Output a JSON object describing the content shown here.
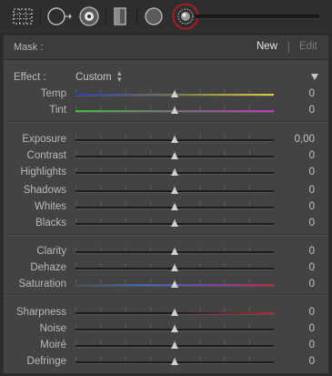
{
  "toolbar": {
    "tools": [
      {
        "name": "crop-overlay-icon"
      },
      {
        "name": "spot-removal-icon"
      },
      {
        "name": "red-eye-icon"
      },
      {
        "name": "graduated-filter-icon"
      },
      {
        "name": "radial-filter-icon"
      },
      {
        "name": "adjustment-brush-icon",
        "highlighted": true
      }
    ],
    "highlight_color": "#c8161d"
  },
  "mask": {
    "label": "Mask :",
    "new_label": "New",
    "edit_label": "Edit"
  },
  "effect": {
    "label": "Effect :",
    "value": "Custom"
  },
  "groups": [
    [
      {
        "label": "Temp",
        "value": "0",
        "position": 0.5,
        "track": "temp"
      },
      {
        "label": "Tint",
        "value": "0",
        "position": 0.5,
        "track": "tint"
      }
    ],
    [
      {
        "label": "Exposure",
        "value": "0,00",
        "position": 0.5,
        "track": "gray"
      },
      {
        "label": "Contrast",
        "value": "0",
        "position": 0.5,
        "track": "gray"
      },
      {
        "label": "Highlights",
        "value": "0",
        "position": 0.5,
        "track": "gray"
      },
      {
        "label": "Shadows",
        "value": "0",
        "position": 0.5,
        "track": "gray"
      },
      {
        "label": "Whites",
        "value": "0",
        "position": 0.5,
        "track": "gray"
      },
      {
        "label": "Blacks",
        "value": "0",
        "position": 0.5,
        "track": "gray"
      }
    ],
    [
      {
        "label": "Clarity",
        "value": "0",
        "position": 0.5,
        "track": "gray"
      },
      {
        "label": "Dehaze",
        "value": "0",
        "position": 0.5,
        "track": "gray"
      },
      {
        "label": "Saturation",
        "value": "0",
        "position": 0.5,
        "track": "saturation"
      }
    ],
    [
      {
        "label": "Sharpness",
        "value": "0",
        "position": 0.5,
        "track": "sharpness"
      },
      {
        "label": "Noise",
        "value": "0",
        "position": 0.5,
        "track": "gray"
      },
      {
        "label": "Moiré",
        "value": "0",
        "position": 0.5,
        "track": "gray"
      },
      {
        "label": "Defringe",
        "value": "0",
        "position": 0.5,
        "track": "gray"
      }
    ]
  ],
  "track_colors": {
    "temp": [
      "#2a3ac0",
      "#7a7a4a",
      "#d8d23a"
    ],
    "tint": [
      "#3ac03a",
      "#7a6a7a",
      "#c03ac0"
    ],
    "saturation": [
      "#4a4a4a",
      "#3a6ab0",
      "#7a40b0",
      "#c02a3a"
    ],
    "sharpness": [
      "#1c1c1c",
      "#1c1c1c",
      "#b02a3a"
    ],
    "gray": [
      "#1c1c1c",
      "#1c1c1c"
    ]
  }
}
